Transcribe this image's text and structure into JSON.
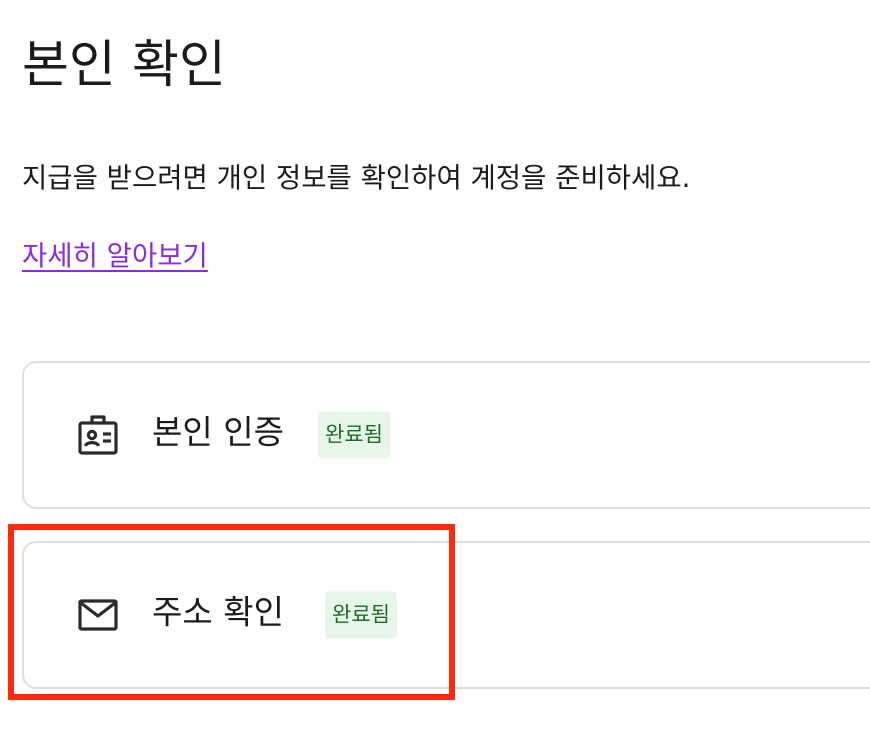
{
  "page": {
    "title": "본인 확인",
    "intro": "지급을 받으려면 개인 정보를 확인하여 계정을 준비하세요.",
    "learn_more": "자세히 알아보기"
  },
  "cards": [
    {
      "label": "본인 인증",
      "icon": "id-badge-icon",
      "status": "완료됨"
    },
    {
      "label": "주소 확인",
      "icon": "mail-icon",
      "status": "완료됨"
    }
  ],
  "colors": {
    "text": "#1b1b1b",
    "link": "#8a2be2",
    "card_border": "#dedede",
    "badge_bg": "#e8f5e9",
    "badge_text": "#1b6e2a",
    "highlight": "#ff2a0c"
  }
}
